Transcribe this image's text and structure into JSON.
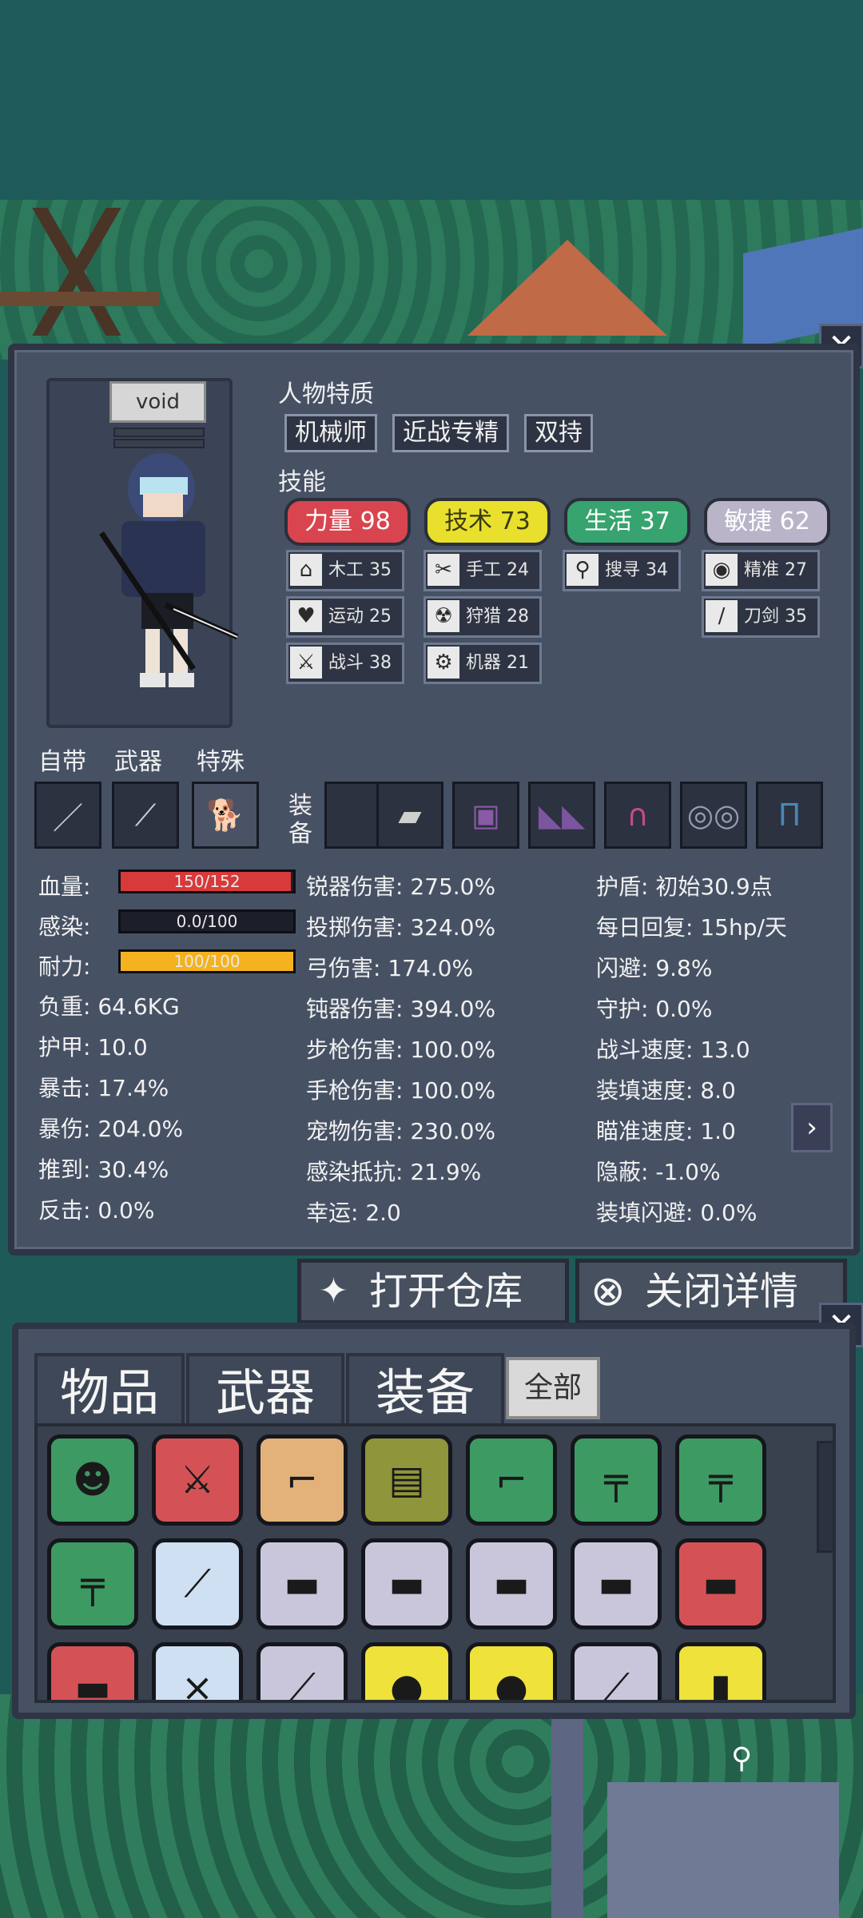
{
  "character": {
    "name": "void"
  },
  "traits": {
    "title": "人物特质",
    "items": [
      "机械师",
      "近战专精",
      "双持"
    ]
  },
  "skills": {
    "title": "技能",
    "attributes": [
      {
        "label": "力量 98",
        "color": "#d9454f",
        "text_color": "#ffffff"
      },
      {
        "label": "技术 73",
        "color": "#e8e02c",
        "text_color": "#3a3a10"
      },
      {
        "label": "生活 37",
        "color": "#37a36f",
        "text_color": "#ffffff"
      },
      {
        "label": "敏捷 62",
        "color": "#b9b4c8",
        "text_color": "#ffffff"
      }
    ],
    "items": [
      {
        "label": "木工 35",
        "icon": "house-icon",
        "glyph": "⌂"
      },
      {
        "label": "手工 24",
        "icon": "scissors-icon",
        "glyph": "✂"
      },
      {
        "label": "搜寻 34",
        "icon": "magnifier-icon",
        "glyph": "⚲"
      },
      {
        "label": "精准 27",
        "icon": "eye-icon",
        "glyph": "◉"
      },
      {
        "label": "刀剑 35",
        "icon": "blade-icon",
        "glyph": "/"
      },
      {
        "label": "运动 25",
        "icon": "heart-icon",
        "glyph": "♥"
      },
      {
        "label": "狩猎 28",
        "icon": "radiation-icon",
        "glyph": "☢"
      },
      {
        "label": "战斗 38",
        "icon": "mace-icon",
        "glyph": "⚔"
      },
      {
        "label": "机器 21",
        "icon": "gear-icon",
        "glyph": "⚙"
      }
    ]
  },
  "slots": {
    "builtin_label": "自带",
    "weapon_label": "武器",
    "special_label": "特殊",
    "equip_label_1": "装",
    "equip_label_2": "备"
  },
  "stats": {
    "hp_label": "血量:",
    "hp_value": "150/152",
    "hp_fill": 0.987,
    "infect_label": "感染:",
    "infect_value": "0.0/100",
    "infect_fill": 0.0,
    "stamina_label": "耐力:",
    "stamina_value": "100/100",
    "stamina_fill": 1.0,
    "col1": [
      "负重: 64.6KG",
      "护甲: 10.0",
      "暴击: 17.4%",
      "暴伤: 204.0%",
      "推到: 30.4%",
      "反击: 0.0%"
    ],
    "col2": [
      "锐器伤害: 275.0%",
      "投掷伤害: 324.0%",
      "弓伤害: 174.0%",
      "钝器伤害: 394.0%",
      "步枪伤害: 100.0%",
      "手枪伤害: 100.0%",
      "宠物伤害: 230.0%",
      "感染抵抗: 21.9%",
      "幸运: 2.0"
    ],
    "col3": [
      "护盾: 初始30.9点",
      "每日回复: 15hp/天",
      "闪避: 9.8%",
      "守护: 0.0%",
      "战斗速度: 13.0",
      "装填速度: 8.0",
      "瞄准速度: 1.0",
      "隐蔽: -1.0%",
      "装填闪避: 0.0%"
    ]
  },
  "buttons": {
    "open_storage": "打开仓库",
    "close_details": "关闭详情"
  },
  "inventory": {
    "tabs": [
      "物品",
      "武器",
      "装备"
    ],
    "all_label": "全部"
  },
  "colors": {
    "panel": "#475164",
    "hp": "#d8393b",
    "stamina": "#f4b21e",
    "item_green": "#3d9a63",
    "item_red": "#d45256",
    "item_tan": "#e2b27a",
    "item_olive": "#8e953a",
    "item_lavender": "#c9c6dc",
    "item_yellow": "#efe23a",
    "item_ice": "#cfe0f3"
  }
}
